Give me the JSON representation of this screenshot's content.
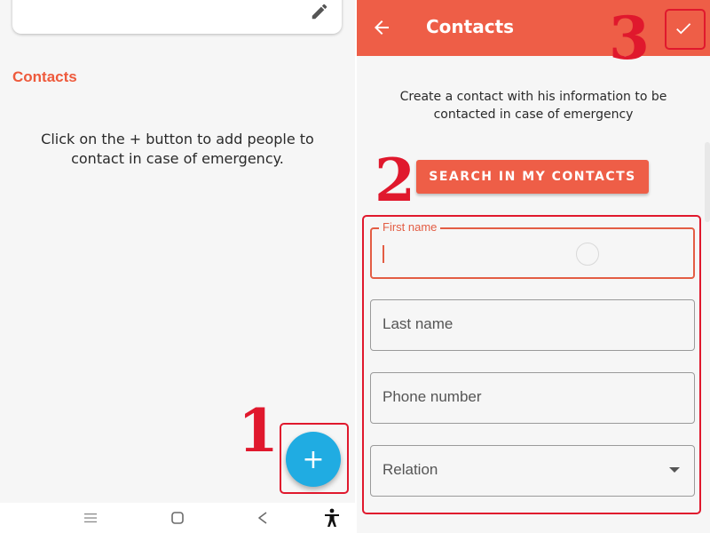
{
  "left": {
    "section_title": "Contacts",
    "empty_message": "Click on the + button to add people to contact in case of emergency.",
    "fab_label": "+",
    "fab_color": "#20ace2",
    "icons": [
      "edit-icon",
      "menu-icon",
      "home-icon",
      "back-icon",
      "accessibility-icon"
    ]
  },
  "right": {
    "title": "Contacts",
    "accent_color": "#ee5e47",
    "intro": "Create a contact with his information to be contacted in case of emergency",
    "search_button": "SEARCH IN MY CONTACTS",
    "fields": {
      "first_name": {
        "label": "First name",
        "value": ""
      },
      "last_name": {
        "placeholder": "Last name"
      },
      "phone": {
        "placeholder": "Phone number"
      },
      "relation": {
        "placeholder": "Relation"
      }
    },
    "icons": [
      "back-arrow-icon",
      "check-icon",
      "chevron-down-icon"
    ]
  },
  "annotations": {
    "color": "#e0182d",
    "step_1": "1",
    "step_2": "2",
    "step_3": "3"
  }
}
